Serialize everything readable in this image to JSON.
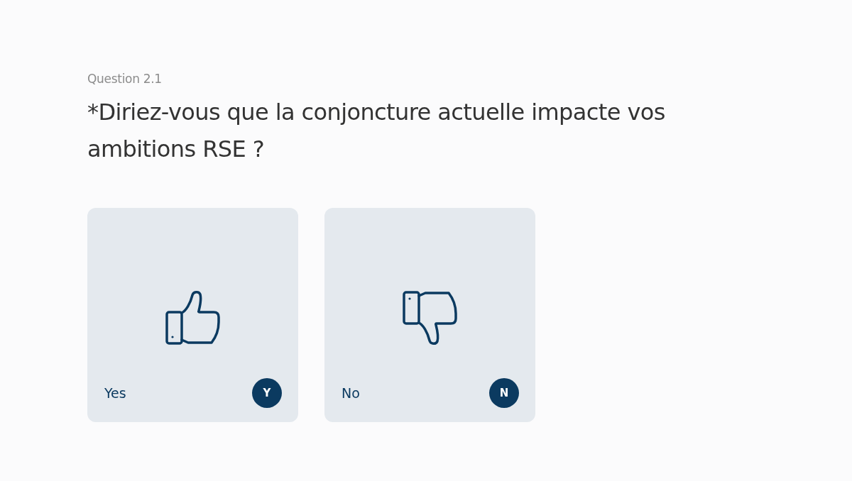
{
  "question": {
    "number": "Question 2.1",
    "text": "*Diriez-vous que la conjoncture actuelle impacte vos ambitions RSE ?"
  },
  "options": [
    {
      "kind": "up",
      "label": "Yes",
      "key": "Y"
    },
    {
      "kind": "down",
      "label": "No",
      "key": "N"
    }
  ]
}
